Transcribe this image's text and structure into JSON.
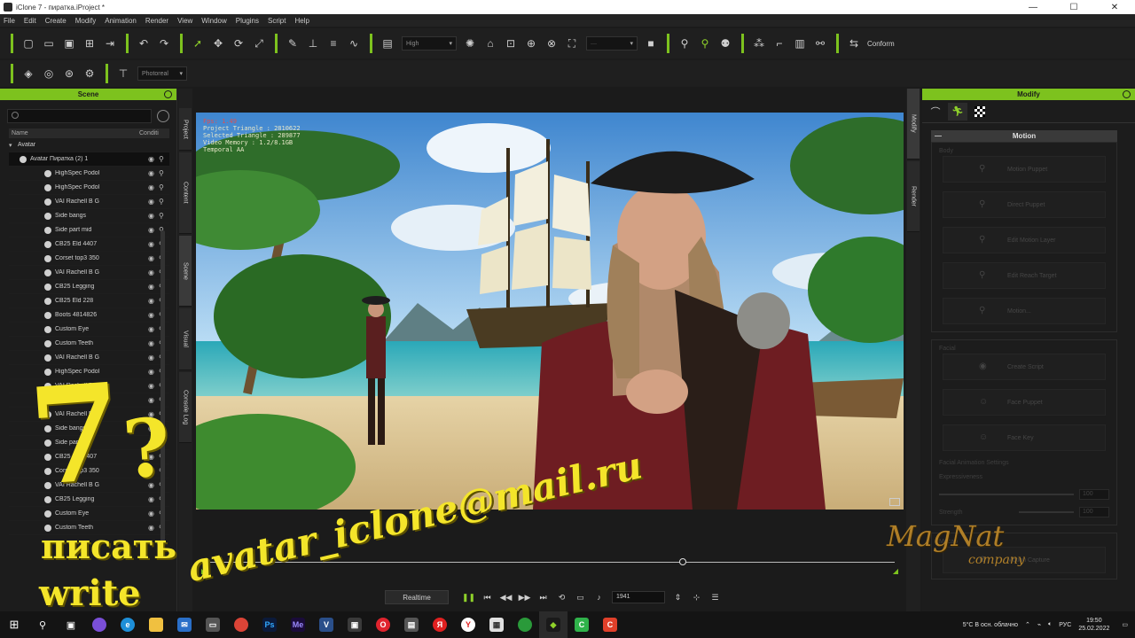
{
  "window": {
    "title": "iClone 7 - пиратка.iProject *",
    "minimize": "—",
    "maximize": "☐",
    "close": "✕"
  },
  "menu": [
    "File",
    "Edit",
    "Create",
    "Modify",
    "Animation",
    "Render",
    "View",
    "Window",
    "Plugins",
    "Script",
    "Help"
  ],
  "toolbar": {
    "quality_select": "High",
    "conform_label": "Conform",
    "render_select": "Photoreal"
  },
  "scene_panel": {
    "title": "Scene",
    "col_name": "Name",
    "col_condition": "Conditi",
    "root": "Avatar",
    "items": [
      "Avatar Пиратка (2) 1",
      "HighSpec Podol",
      "HighSpec Podol",
      "VAI Rachell B G",
      "Side bangs",
      "Side part mid",
      "CB25 Eld 4407",
      "Corset top3 350",
      "VAI Rachell B G",
      "CB25 Legging",
      "CB25 Eld 228",
      "Boots 4814826",
      "Custom Eye",
      "Custom Teeth",
      "VAI Rachell B G",
      "HighSpec Podol",
      "VAI Rachell B G",
      "HighSpec Podol",
      "VAI Rachell B G",
      "Side bangs",
      "Side part mid",
      "CB25 Eld 4407",
      "Corset top3 350",
      "VAI Rachell B G",
      "CB25 Legging",
      "Custom Eye",
      "Custom Teeth"
    ]
  },
  "left_tabs": [
    "Project",
    "Content",
    "Scene",
    "Visual",
    "Console Log"
  ],
  "right_tabs": [
    "Modify",
    "Render"
  ],
  "viewport": {
    "stats": [
      "Fps: 1.49",
      "Project Triangle : 2810622",
      "Selected Triangle : 289877",
      "Video Memory : 1.2/8.1GB",
      "Temporal AA"
    ]
  },
  "timeline": {
    "realtime_label": "Realtime",
    "frame_value": "1941"
  },
  "modify_panel": {
    "title": "Modify",
    "motion": {
      "title": "Motion",
      "subheading": "Body",
      "buttons": [
        "Motion Puppet",
        "Direct Puppet",
        "Edit Motion Layer",
        "Edit Reach Target",
        "Motion..."
      ]
    },
    "facial": {
      "title": "Facial",
      "buttons": [
        "Create Script",
        "Face Puppet",
        "Face Key"
      ],
      "settings_label": "Facial Animation Settings",
      "slider1_label": "Expressiveness",
      "slider1_value": "100",
      "slider2_label": "Strength",
      "slider2_value": "100"
    },
    "mocap": {
      "title": "Mocap",
      "button": "Motion Capture"
    }
  },
  "overlay": {
    "number": "7",
    "question": "?",
    "line1": "писать",
    "line2": "write",
    "email": "avatar_iclone@mail.ru",
    "brand": "MagNat",
    "brand_sub": "company"
  },
  "taskbar": {
    "weather": "5°C  В осн. облачно",
    "lang": "РУС",
    "time": "19:50",
    "date": "25.02.2022"
  },
  "colors": {
    "accent_green": "#7dc21e",
    "overlay_yellow": "#f4e52a"
  }
}
